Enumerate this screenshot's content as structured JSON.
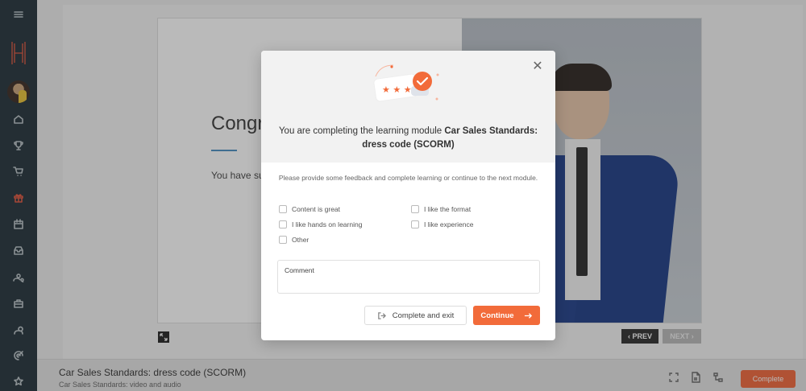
{
  "slide": {
    "heading": "Congr",
    "text": "You have suc",
    "prev_label": "‹ PREV",
    "next_label": "NEXT ›"
  },
  "bottom_bar": {
    "title": "Car Sales Standards: dress code (SCORM)",
    "subtitle": "Car Sales Standards: video and audio",
    "complete_label": "Complete"
  },
  "modal": {
    "title_prefix": "You are completing the learning module ",
    "module_name": "Car Sales Standards: dress code (SCORM)",
    "description": "Please provide some feedback and complete learning or continue to the next module.",
    "options": {
      "content_great": "Content is great",
      "like_format": "I like the format",
      "hands_on": "I like hands on learning",
      "like_experience": "I like experience",
      "other": "Other"
    },
    "comment_label": "Comment",
    "complete_exit_label": "Complete and exit",
    "continue_label": "Continue",
    "close_glyph": "✕"
  },
  "colors": {
    "accent": "#f26b3a",
    "sidebar": "#22323a",
    "sidebar_active": "#e0553d"
  }
}
